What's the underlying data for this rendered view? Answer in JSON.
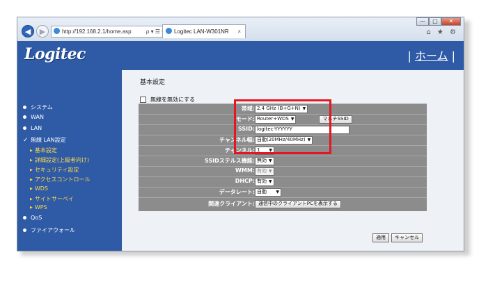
{
  "browser": {
    "url": "http://192.168.2.1/home.asp",
    "url_controls": "ρ ▾ ☰ C",
    "tab_title": "Logitec LAN-W301NR",
    "tab_close": "×",
    "toolbar_icons": "⌂ ★ ⚙",
    "window_controls": {
      "minimize": "—",
      "maximize": "□",
      "close": "✕"
    }
  },
  "header": {
    "logo": "Logitec",
    "home_link": "ホーム"
  },
  "sidebar": {
    "items": [
      {
        "label": "システム"
      },
      {
        "label": "WAN"
      },
      {
        "label": "LAN"
      },
      {
        "label": "無線 LAN設定"
      },
      {
        "label": "QoS"
      },
      {
        "label": "ファイアウォール"
      }
    ],
    "wireless_sub": [
      {
        "label": "基本設定"
      },
      {
        "label": "詳細設定(上級者向け)"
      },
      {
        "label": "セキュリティ設定"
      },
      {
        "label": "アクセスコントロール"
      },
      {
        "label": "WDS"
      },
      {
        "label": "サイトサーベイ"
      },
      {
        "label": "WPS"
      }
    ]
  },
  "main": {
    "title": "基本設定",
    "disable_wireless_label": "無線を無効にする",
    "rows": {
      "band": {
        "label": "帯域:",
        "value": "2.4 GHz (B+G+N)"
      },
      "mode": {
        "label": "モード:",
        "value": "Router+WDS",
        "button": "マルチSSID"
      },
      "ssid": {
        "label": "SSID:",
        "value": "logitec-YYYYYY"
      },
      "channel_width": {
        "label": "チャンネル幅:",
        "value": "自動(20MHz/40MHz)"
      },
      "channel": {
        "label": "チャンネル:",
        "value": "1"
      },
      "ssid_stealth": {
        "label": "SSIDステルス機能:",
        "value": "無効"
      },
      "wmm": {
        "label": "WMM:",
        "value": "有効"
      },
      "dhcp": {
        "label": "DHCP:",
        "value": "有効"
      },
      "data_rate": {
        "label": "データレート:",
        "value": "自動"
      },
      "clients": {
        "label": "関連クライアント:",
        "button": "通信中のクライアントPCを表示する"
      }
    },
    "apply_button": "適用",
    "cancel_button": "キャンセル"
  },
  "colors": {
    "brand_blue": "#2e5aa6",
    "highlight_red": "#e5161f",
    "sub_menu_yellow": "#ffd94a",
    "table_gray": "#8c8c8c"
  }
}
